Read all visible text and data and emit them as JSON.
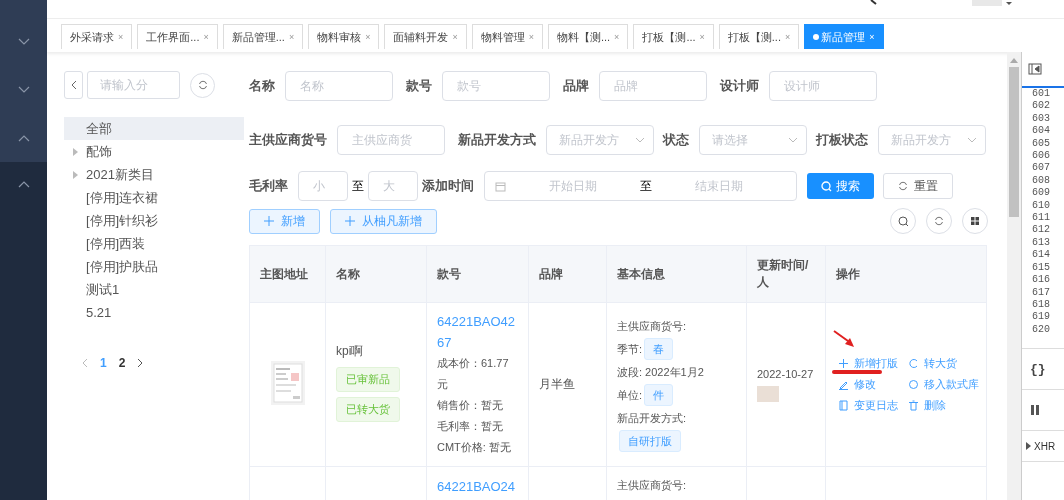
{
  "sidebar": {
    "items": [
      {
        "expanded": false
      },
      {
        "expanded": false
      },
      {
        "expanded": true
      },
      {
        "expanded": true
      }
    ]
  },
  "tabs": [
    {
      "label": "外采请求",
      "close": "×",
      "selected": false
    },
    {
      "label": "工作界面...",
      "close": "×",
      "selected": false
    },
    {
      "label": "新品管理...",
      "close": "×",
      "selected": false
    },
    {
      "label": "物料审核",
      "close": "×",
      "selected": false
    },
    {
      "label": "面辅料开发",
      "close": "×",
      "selected": false
    },
    {
      "label": "物料管理",
      "close": "×",
      "selected": false
    },
    {
      "label": "物料【测...",
      "close": "×",
      "selected": false
    },
    {
      "label": "打板【测...",
      "close": "×",
      "selected": false
    },
    {
      "label": "打板【测...",
      "close": "×",
      "selected": false
    },
    {
      "label": "新品管理",
      "close": "×",
      "selected": true
    }
  ],
  "category_panel": {
    "search_placeholder": "请输入分",
    "tree": [
      {
        "label": "全部",
        "selected": true,
        "has_children": false
      },
      {
        "label": "配饰",
        "selected": false,
        "has_children": true
      },
      {
        "label": "2021新类目",
        "selected": false,
        "has_children": true
      },
      {
        "label": "[停用]连衣裙",
        "selected": false,
        "has_children": false
      },
      {
        "label": "[停用]针织衫",
        "selected": false,
        "has_children": false
      },
      {
        "label": "[停用]西装",
        "selected": false,
        "has_children": false
      },
      {
        "label": "[停用]护肤品",
        "selected": false,
        "has_children": false
      },
      {
        "label": "测试1",
        "selected": false,
        "has_children": false
      },
      {
        "label": "5.21",
        "selected": false,
        "has_children": false
      }
    ],
    "pages": [
      {
        "label": "1",
        "selected": true
      },
      {
        "label": "2",
        "selected": false
      }
    ]
  },
  "filters": [
    [
      {
        "kind": "input",
        "label": "名称",
        "placeholder": "名称"
      },
      {
        "kind": "input",
        "label": "款号",
        "placeholder": "款号"
      },
      {
        "kind": "input",
        "label": "品牌",
        "placeholder": "品牌"
      },
      {
        "kind": "input",
        "label": "设计师",
        "placeholder": "设计师"
      }
    ],
    [
      {
        "kind": "input",
        "label": "主供应商货号",
        "placeholder": "主供应商货"
      },
      {
        "kind": "select",
        "label": "新品开发方式",
        "placeholder": "新品开发方"
      },
      {
        "kind": "select",
        "label": "状态",
        "placeholder": "请选择"
      },
      {
        "kind": "select",
        "label": "打板状态",
        "placeholder": "新品开发方"
      }
    ],
    [
      {
        "kind": "range",
        "label": "毛利率",
        "min": {
          "placeholder": "小"
        },
        "sep": "至",
        "max": {
          "placeholder": "大"
        }
      },
      {
        "kind": "daterange",
        "label": "添加时间",
        "start": {
          "placeholder": "开始日期"
        },
        "sep": "至",
        "end": {
          "placeholder": "结束日期"
        }
      }
    ]
  ],
  "search_button": "搜索",
  "reset_button": "重置",
  "add_buttons": [
    "新增",
    "从柚凡新增"
  ],
  "table": {
    "columns": [
      "主图地址",
      "名称",
      "款号",
      "品牌",
      "基本信息",
      "更新时间/人",
      "操作"
    ],
    "rows": [
      {
        "image": {
          "kind": "picture"
        },
        "name": "kpi啊",
        "tags": [
          "已审新品",
          "已转大货"
        ],
        "code": "64221BAO4267",
        "code_details": [
          "成本价：61.77元",
          "销售价：暂无",
          "毛利率：暂无",
          "CMT价格: 暂无"
        ],
        "brand": "月半鱼",
        "info": [
          {
            "kind": "text",
            "text": "主供应商货号:"
          },
          {
            "kind": "tag",
            "label": "季节:",
            "tag": "春"
          },
          {
            "kind": "text",
            "text": "波段: 2022年1月2"
          },
          {
            "kind": "tag",
            "label": "单位:",
            "tag": "件"
          },
          {
            "kind": "text",
            "text": "新品开发方式:"
          },
          {
            "kind": "tagonly",
            "tag": "自研打版"
          }
        ],
        "updated": "2022-10-27",
        "operations": [
          {
            "kind": "add",
            "label": "新增打版"
          },
          {
            "kind": "convert",
            "label": "转大货"
          },
          {
            "kind": "edit",
            "label": "修改"
          },
          {
            "kind": "move",
            "label": "移入款式库"
          },
          {
            "kind": "log",
            "label": "变更日志"
          },
          {
            "kind": "delete",
            "label": "删除"
          }
        ]
      },
      {
        "code": "64221BAO24",
        "info": [
          {
            "kind": "text",
            "text": "主供应商货号:"
          }
        ]
      }
    ]
  },
  "devtools": {
    "line_numbers": [
      "601",
      "602",
      "603",
      "604",
      "605",
      "606",
      "607",
      "608",
      "609",
      "610",
      "611",
      "612",
      "613",
      "614",
      "615",
      "616",
      "617",
      "618",
      "619",
      "620"
    ],
    "format_button": "{}",
    "xhr_section": "XHR"
  }
}
